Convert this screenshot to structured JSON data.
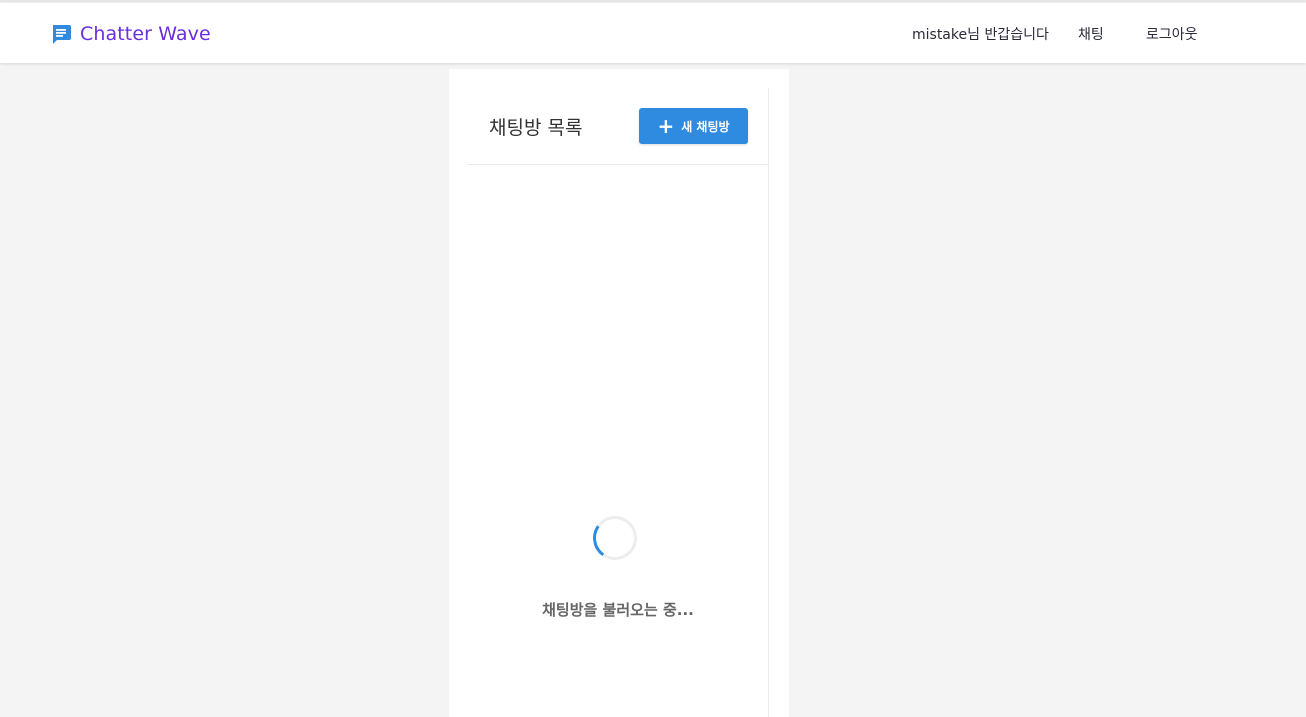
{
  "app": {
    "name": "Chatter Wave",
    "brand_color": "#6b2ee0",
    "logo_icon": "chat-bubble-icon",
    "logo_color": "#2f8be0"
  },
  "nav": {
    "greeting": "mistake님 반갑습니다",
    "chat_link": "채팅",
    "logout_link": "로그아웃"
  },
  "chat_list": {
    "title": "채팅방 목록",
    "new_room_button": {
      "icon": "plus-icon",
      "label": "새 채팅방",
      "color": "#2f8be0"
    },
    "loading_text": "채팅방을 불러오는 중..."
  }
}
